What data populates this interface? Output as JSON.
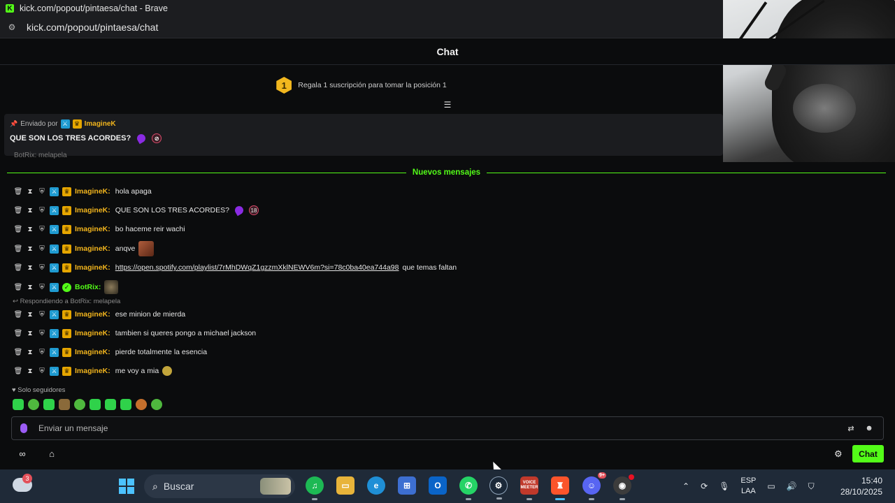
{
  "browser": {
    "window_title": "kick.com/popout/pintaesa/chat - Brave",
    "url": "kick.com/popout/pintaesa/chat"
  },
  "chat": {
    "header_title": "Chat",
    "leaderboard": {
      "rank": "1",
      "text": "Regala 1 suscripción para tomar la posición 1"
    },
    "pinned": {
      "sent_by_label": "Enviado por",
      "username": "ImagineK",
      "message": "QUE SON LOS TRES ACORDES?"
    },
    "partial_row": "BotRix: melapela",
    "new_messages_label": "Nuevos mensajes",
    "messages": [
      {
        "username": "ImagineK:",
        "text": "hola apaga"
      },
      {
        "username": "ImagineK:",
        "text": "QUE SON LOS TRES ACORDES?",
        "age_badge": "18"
      },
      {
        "username": "ImagineK:",
        "text": "bo haceme reir wachi"
      },
      {
        "username": "ImagineK:",
        "text": "anqve"
      },
      {
        "username": "ImagineK:",
        "link": "https://open.spotify.com/playlist/7rMhDWqZ1gzzmXklNEWV6m?si=78c0ba40ea744a98",
        "text": "que temas faltan"
      },
      {
        "username": "BotRix:",
        "text": ""
      },
      {
        "username": "ImagineK:",
        "text": "ese minion de mierda"
      },
      {
        "username": "ImagineK:",
        "text": "tambien si queres pongo a michael jackson"
      },
      {
        "username": "ImagineK:",
        "text": "pierde totalmente la esencia"
      },
      {
        "username": "ImagineK:",
        "text": "me voy a mia"
      }
    ],
    "reply_note": "Respondiendo a BotRix: melapela",
    "followers_only": "Solo seguidores",
    "input_placeholder": "Enviar un mensaje",
    "send_button": "Chat"
  },
  "taskbar": {
    "weather_badge": "3",
    "search_label": "Buscar",
    "lang_top": "ESP",
    "lang_bottom": "LAA",
    "time": "15:40",
    "date": "28/10/2025",
    "voicemeeter_label": "VOICE MEETER",
    "discord_badge": "9+"
  },
  "colors": {
    "kick_green": "#53fc18",
    "username_gold": "#f1b41d",
    "mod_blue": "#1f9bd1"
  }
}
